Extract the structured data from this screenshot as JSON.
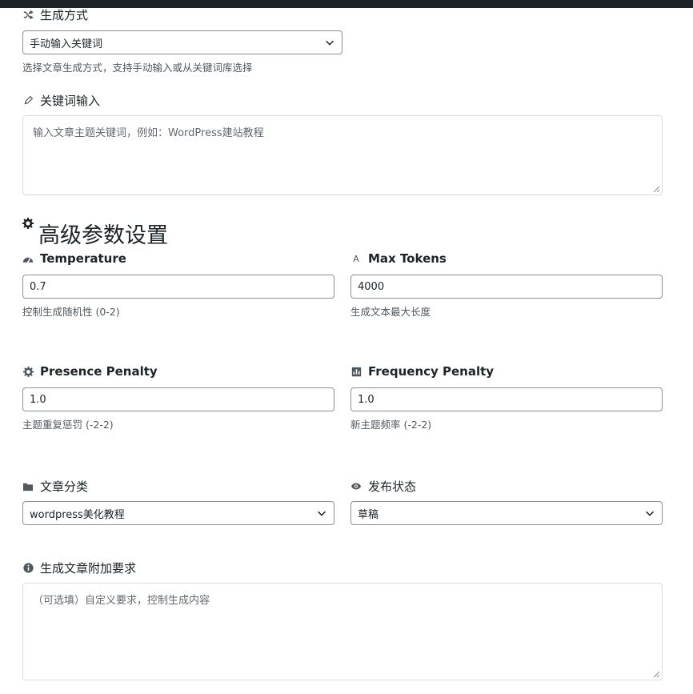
{
  "generation": {
    "label": "生成方式",
    "icon": "shuffle-icon",
    "selected": "手动输入关键词",
    "help": "选择文章生成方式，支持手动输入或从关键词库选择"
  },
  "keywords": {
    "label": "关键词输入",
    "icon": "pencil-icon",
    "placeholder": "输入文章主题关键词，例如：WordPress建站教程"
  },
  "advanced": {
    "title": "高级参数设置",
    "icon": "gear-icon"
  },
  "temperature": {
    "label": "Temperature",
    "icon": "dashboard-icon",
    "value": "0.7",
    "help": "控制生成随机性 (0-2)"
  },
  "max_tokens": {
    "label": "Max Tokens",
    "icon": "text-icon",
    "value": "4000",
    "help": "生成文本最大长度"
  },
  "presence_penalty": {
    "label": "Presence Penalty",
    "icon": "gear-icon",
    "value": "1.0",
    "help": "主题重复惩罚 (-2-2)"
  },
  "frequency_penalty": {
    "label": "Frequency Penalty",
    "icon": "chart-icon",
    "value": "1.0",
    "help": "新主题频率 (-2-2)"
  },
  "category": {
    "label": "文章分类",
    "icon": "folder-icon",
    "selected": "wordpress美化教程"
  },
  "status": {
    "label": "发布状态",
    "icon": "eye-icon",
    "selected": "草稿"
  },
  "extra": {
    "label": "生成文章附加要求",
    "icon": "info-icon",
    "placeholder": "（可选填）自定义要求，控制生成内容"
  }
}
